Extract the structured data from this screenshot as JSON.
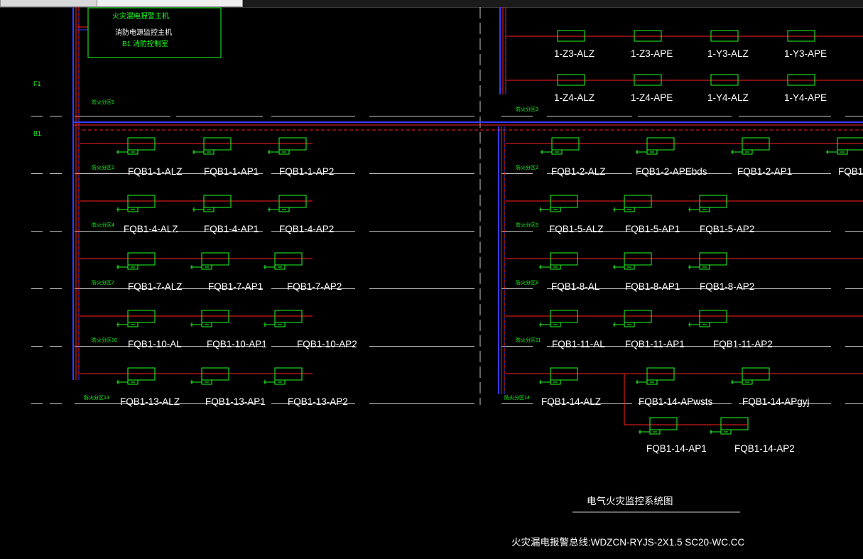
{
  "tabs": [
    {
      "label": "",
      "active": true
    },
    {
      "label": "",
      "active": false
    }
  ],
  "host": {
    "title": "火灾漏电报警主机",
    "subtitle": "消防电源监控主机",
    "location": "B1 消防控制室"
  },
  "floors": {
    "f1": "F1",
    "b1": "B1"
  },
  "zones": {
    "z5": "防火分区5",
    "z3": "防火分区3",
    "z1": "防火分区1",
    "z2": "防火分区2",
    "z4": "防火分区4",
    "z5b": "防火分区5",
    "z7": "防火分区7",
    "z8": "防火分区8",
    "z10": "防火分区10",
    "z11": "防火分区11",
    "z13": "防火分区13",
    "z14": "防火分区14"
  },
  "f1_boxes": [
    [
      "1-Z3-ALZ",
      "1-Z3-APE",
      "1-Y3-ALZ",
      "1-Y3-APE"
    ],
    [
      "1-Z4-ALZ",
      "1-Z4-APE",
      "1-Y4-ALZ",
      "1-Y4-APE"
    ]
  ],
  "left_rows": [
    [
      "FQB1-1-ALZ",
      "FQB1-1-AP1",
      "FQB1-1-AP2"
    ],
    [
      "FQB1-4-ALZ",
      "FQB1-4-AP1",
      "FQB1-4-AP2"
    ],
    [
      "FQB1-7-ALZ",
      "FQB1-7-AP1",
      "FQB1-7-AP2"
    ],
    [
      "FQB1-10-AL",
      "FQB1-10-AP1",
      "FQB1-10-AP2"
    ],
    [
      "FQB1-13-ALZ",
      "FQB1-13-AP1",
      "FQB1-13-AP2"
    ]
  ],
  "right_rows": [
    [
      "FQB1-2-ALZ",
      "FQB1-2-APEbds",
      "FQB1-2-AP1",
      "FQB1-"
    ],
    [
      "FQB1-5-ALZ",
      "FQB1-5-AP1",
      "FQB1-5-AP2"
    ],
    [
      "FQB1-8-AL",
      "FQB1-8-AP1",
      "FQB1-8-AP2"
    ],
    [
      "FQB1-11-AL",
      "FQB1-11-AP1",
      "FQB1-11-AP2"
    ],
    [
      "FQB1-14-ALZ",
      "FQB1-14-APwsts",
      "FQB1-14-APgyj"
    ]
  ],
  "extra_row": [
    "FQB1-14-AP1",
    "FQB1-14-AP2"
  ],
  "title": "电气火灾监控系统图",
  "cable_note": "火灾漏电报警总线:WDZCN-RYJS-2X1.5  SC20-WC.CC",
  "colors": {
    "bus": "#ff2020",
    "box": "#20ff20",
    "trunk": "#3a3aff",
    "text": "#ffffff",
    "dash": "#c8c8c8"
  }
}
